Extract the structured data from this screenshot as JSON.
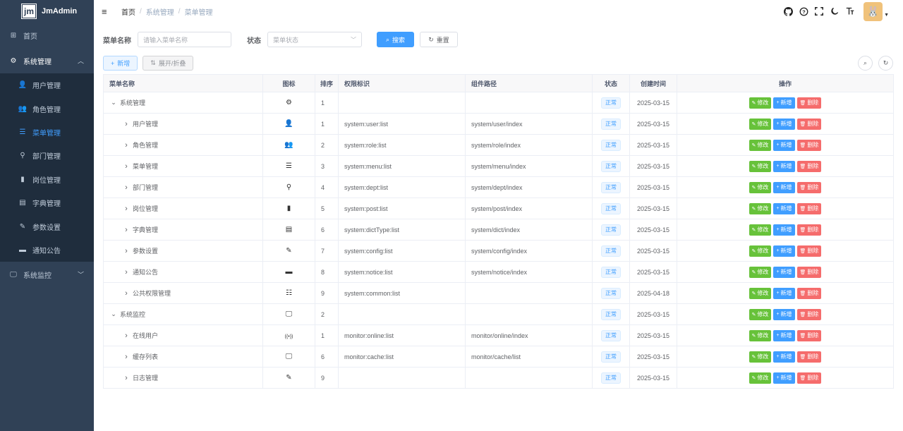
{
  "app": {
    "logo_mark": "jm",
    "title": "JmAdmin"
  },
  "sidebar": {
    "home": {
      "label": "首页",
      "icon": "dashboard-icon"
    },
    "system": {
      "label": "系统管理",
      "icon": "gear-icon"
    },
    "sub_items": [
      {
        "label": "用户管理",
        "icon": "user-icon",
        "glyph": "👤"
      },
      {
        "label": "角色管理",
        "icon": "peoples-icon",
        "glyph": "👥"
      },
      {
        "label": "菜单管理",
        "icon": "tree-table-icon",
        "glyph": "☰"
      },
      {
        "label": "部门管理",
        "icon": "tree-icon",
        "glyph": "⚲"
      },
      {
        "label": "岗位管理",
        "icon": "post-icon",
        "glyph": "▮"
      },
      {
        "label": "字典管理",
        "icon": "dict-icon",
        "glyph": "▤"
      },
      {
        "label": "参数设置",
        "icon": "edit-icon",
        "glyph": "✎"
      },
      {
        "label": "通知公告",
        "icon": "message-icon",
        "glyph": "▬"
      }
    ],
    "monitor": {
      "label": "系统监控",
      "icon": "monitor-icon"
    }
  },
  "breadcrumb": {
    "home": "首页",
    "level1": "系统管理",
    "level2": "菜单管理"
  },
  "search": {
    "name_label": "菜单名称",
    "name_placeholder": "请输入菜单名称",
    "status_label": "状态",
    "status_placeholder": "菜单状态",
    "search_button": "搜索",
    "reset_button": "重置"
  },
  "toolbar": {
    "add_button": "新增",
    "expand_button": "展开/折叠"
  },
  "table": {
    "headers": [
      "菜单名称",
      "图标",
      "排序",
      "权限标识",
      "组件路径",
      "状态",
      "创建时间",
      "操作"
    ],
    "op_labels": {
      "edit": "修改",
      "add": "新增",
      "delete": "删除"
    },
    "rows": [
      {
        "name": "系统管理",
        "level": 0,
        "expanded": true,
        "icon": "gear-icon",
        "glyph": "⚙",
        "order": "1",
        "perms": "",
        "component": "",
        "status": "正常",
        "created": "2025-03-15"
      },
      {
        "name": "用户管理",
        "level": 1,
        "expanded": false,
        "icon": "user-icon",
        "glyph": "👤",
        "order": "1",
        "perms": "system:user:list",
        "component": "system/user/index",
        "status": "正常",
        "created": "2025-03-15"
      },
      {
        "name": "角色管理",
        "level": 1,
        "expanded": false,
        "icon": "peoples-icon",
        "glyph": "👥",
        "order": "2",
        "perms": "system:role:list",
        "component": "system/role/index",
        "status": "正常",
        "created": "2025-03-15"
      },
      {
        "name": "菜单管理",
        "level": 1,
        "expanded": false,
        "icon": "tree-table-icon",
        "glyph": "☰",
        "order": "3",
        "perms": "system:menu:list",
        "component": "system/menu/index",
        "status": "正常",
        "created": "2025-03-15"
      },
      {
        "name": "部门管理",
        "level": 1,
        "expanded": false,
        "icon": "tree-icon",
        "glyph": "⚲",
        "order": "4",
        "perms": "system:dept:list",
        "component": "system/dept/index",
        "status": "正常",
        "created": "2025-03-15"
      },
      {
        "name": "岗位管理",
        "level": 1,
        "expanded": false,
        "icon": "post-icon",
        "glyph": "▮",
        "order": "5",
        "perms": "system:post:list",
        "component": "system/post/index",
        "status": "正常",
        "created": "2025-03-15"
      },
      {
        "name": "字典管理",
        "level": 1,
        "expanded": false,
        "icon": "dict-icon",
        "glyph": "▤",
        "order": "6",
        "perms": "system:dictType:list",
        "component": "system/dict/index",
        "status": "正常",
        "created": "2025-03-15"
      },
      {
        "name": "参数设置",
        "level": 1,
        "expanded": false,
        "icon": "edit-icon",
        "glyph": "✎",
        "order": "7",
        "perms": "system:config:list",
        "component": "system/config/index",
        "status": "正常",
        "created": "2025-03-15"
      },
      {
        "name": "通知公告",
        "level": 1,
        "expanded": false,
        "icon": "message-icon",
        "glyph": "▬",
        "order": "8",
        "perms": "system:notice:list",
        "component": "system/notice/index",
        "status": "正常",
        "created": "2025-03-15"
      },
      {
        "name": "公共权限管理",
        "level": 1,
        "expanded": false,
        "icon": "slider-icon",
        "glyph": "☷",
        "order": "9",
        "perms": "system:common:list",
        "component": "",
        "status": "正常",
        "created": "2025-04-18"
      },
      {
        "name": "系统监控",
        "level": 0,
        "expanded": true,
        "icon": "monitor-icon",
        "glyph": "🖵",
        "order": "2",
        "perms": "",
        "component": "",
        "status": "正常",
        "created": "2025-03-15"
      },
      {
        "name": "在线用户",
        "level": 1,
        "expanded": false,
        "icon": "online-icon",
        "glyph": "((•))",
        "order": "1",
        "perms": "monitor:online:list",
        "component": "monitor/online/index",
        "status": "正常",
        "created": "2025-03-15"
      },
      {
        "name": "缓存列表",
        "level": 1,
        "expanded": false,
        "icon": "monitor-icon",
        "glyph": "🖵",
        "order": "6",
        "perms": "monitor:cache:list",
        "component": "monitor/cache/list",
        "status": "正常",
        "created": "2025-03-15"
      },
      {
        "name": "日志管理",
        "level": 1,
        "expanded": false,
        "icon": "log-icon",
        "glyph": "✎",
        "order": "9",
        "perms": "",
        "component": "",
        "status": "正常",
        "created": "2025-03-15"
      }
    ]
  },
  "colors": {
    "sidebar_bg": "#304156",
    "submenu_bg": "#1f2d3d",
    "primary": "#409eff",
    "success": "#67c23a",
    "danger": "#f56c6c"
  }
}
